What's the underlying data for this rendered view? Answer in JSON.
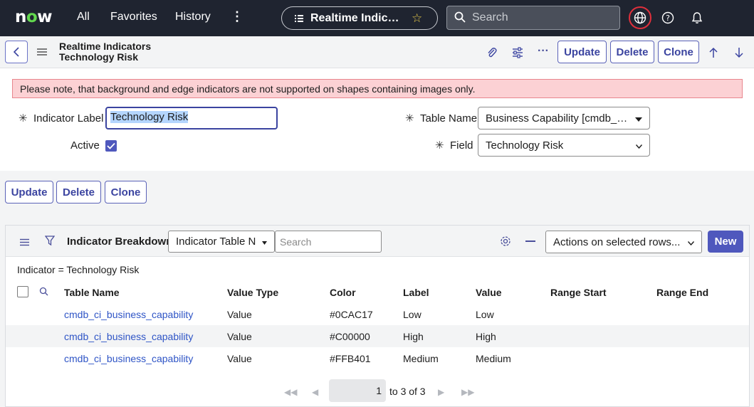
{
  "topnav": {
    "logo": "now",
    "links": [
      "All",
      "Favorites",
      "History"
    ],
    "pill_text": "Realtime Indicat…",
    "search_placeholder": "Search"
  },
  "form_header": {
    "title_line1": "Realtime Indicators",
    "title_line2": "Technology Risk",
    "update": "Update",
    "delete": "Delete",
    "clone": "Clone"
  },
  "alert": "Please note, that background and edge indicators are not supported on shapes containing images only.",
  "fields": {
    "indicator_label_label": "Indicator Label",
    "indicator_label_value": "Technology Risk",
    "active_label": "Active",
    "table_name_label": "Table Name",
    "table_name_value": "Business Capability [cmdb_ci_b…",
    "field_label": "Field",
    "field_value": "Technology Risk"
  },
  "bottom_buttons": {
    "update": "Update",
    "delete": "Delete",
    "clone": "Clone"
  },
  "related_list": {
    "title": "Indicator Breakdowns",
    "filter_select": "Indicator Table Na",
    "search_placeholder": "Search",
    "actions": "Actions on selected rows...",
    "new": "New",
    "breadcrumb": "Indicator = Technology Risk",
    "columns": [
      "Table Name",
      "Value Type",
      "Color",
      "Label",
      "Value",
      "Range Start",
      "Range End"
    ],
    "rows": [
      [
        "cmdb_ci_business_capability",
        "Value",
        "#0CAC17",
        "Low",
        "Low",
        "",
        ""
      ],
      [
        "cmdb_ci_business_capability",
        "Value",
        "#C00000",
        "High",
        "High",
        "",
        ""
      ],
      [
        "cmdb_ci_business_capability",
        "Value",
        "#FFB401",
        "Medium",
        "Medium",
        "",
        ""
      ]
    ],
    "pager_current": "1",
    "pager_of": "to 3 of 3"
  }
}
